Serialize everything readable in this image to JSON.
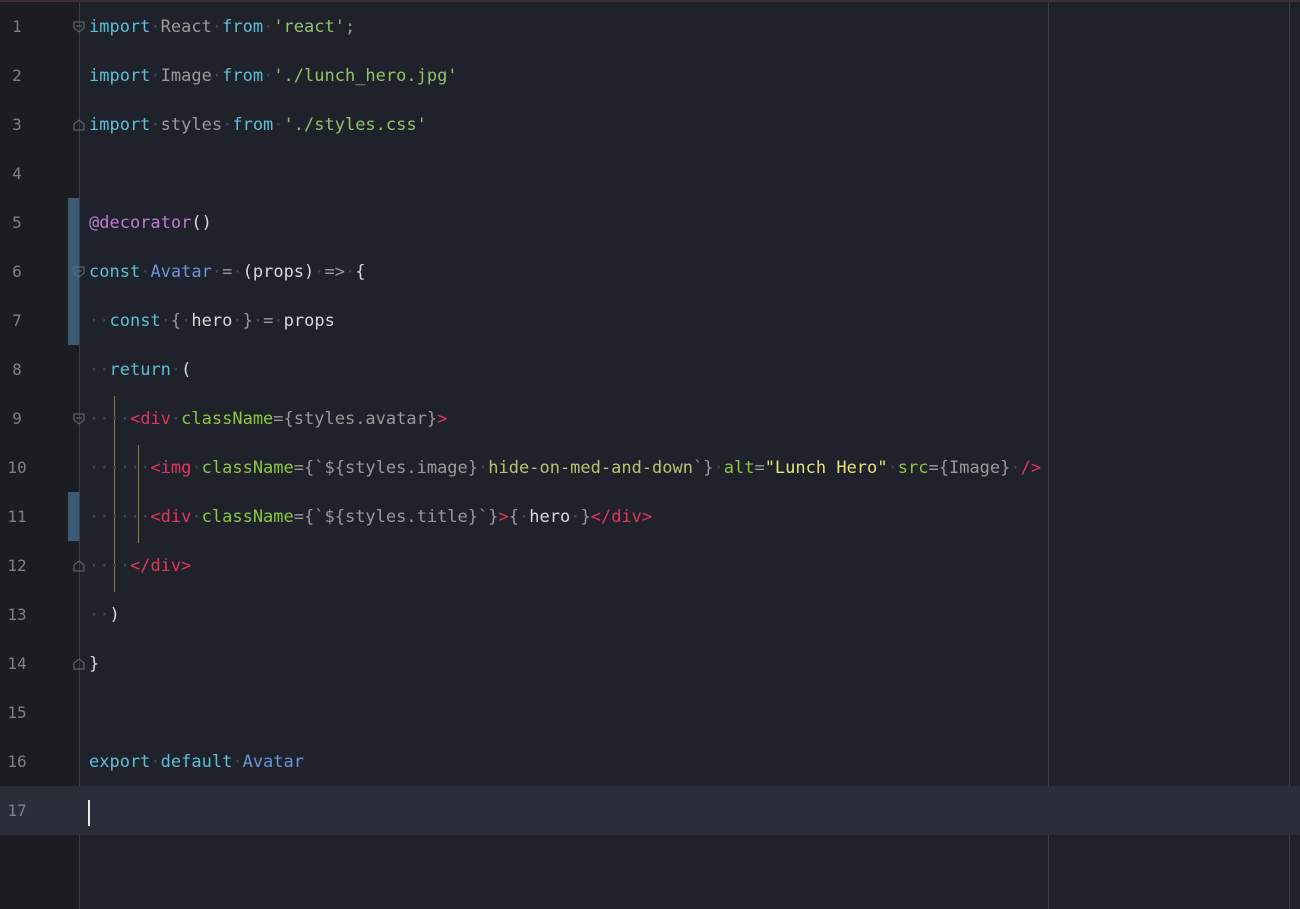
{
  "editor": {
    "language": "jsx",
    "current_line": 17,
    "lines": [
      {
        "number": "1"
      },
      {
        "number": "2"
      },
      {
        "number": "3"
      },
      {
        "number": "4"
      },
      {
        "number": "5"
      },
      {
        "number": "6"
      },
      {
        "number": "7"
      },
      {
        "number": "8"
      },
      {
        "number": "9"
      },
      {
        "number": "10"
      },
      {
        "number": "11"
      },
      {
        "number": "12"
      },
      {
        "number": "13"
      },
      {
        "number": "14"
      },
      {
        "number": "15"
      },
      {
        "number": "16"
      },
      {
        "number": "17"
      }
    ],
    "tokens": {
      "import": "import",
      "from": "from",
      "react_id": "React",
      "react_str": "'react'",
      "image_id": "Image",
      "image_str": "'./lunch_hero.jpg'",
      "styles_id": "styles",
      "styles_str": "'./styles.css'",
      "decorator": "@decorator",
      "const": "const",
      "avatar": "Avatar",
      "props": "props",
      "hero": "hero",
      "return": "return",
      "div": "div",
      "img": "img",
      "classname": "className",
      "alt": "alt",
      "alt_value": "\"Lunch Hero\"",
      "src": "src",
      "styles_avatar": "styles.avatar",
      "styles_image": "styles.image",
      "hide_class": "hide-on-med-and-down",
      "styles_title": "styles.title",
      "export": "export",
      "default": "default"
    }
  },
  "colors": {
    "background": "#1f222a",
    "gutter": "#1b1d23",
    "current_line": "#2a2e3b",
    "keyword": "#5bc0d7",
    "string": "#8fc46b",
    "tag": "#e0375a",
    "attribute": "#8bc83c",
    "decorator": "#c377d6",
    "class_name": "#6c92db",
    "change_marker": "#3c5a73"
  }
}
